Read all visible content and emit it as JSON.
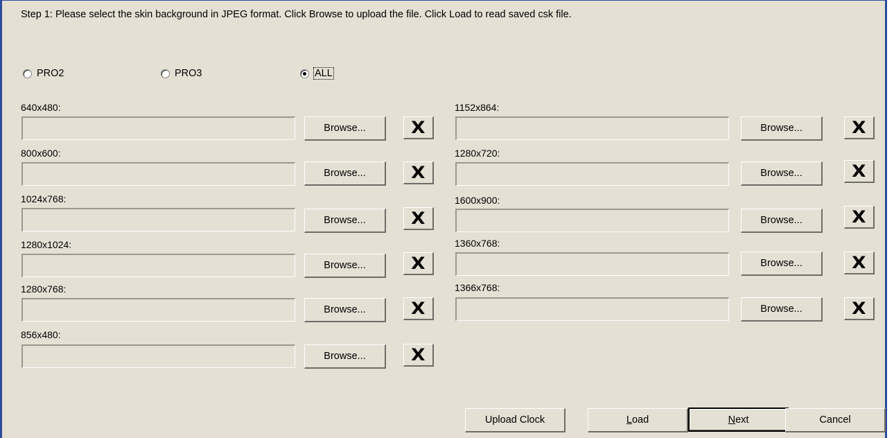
{
  "instruction": "Step 1: Please select the skin background in JPEG format. Click Browse to upload the file. Click Load to read saved csk file.",
  "radios": [
    {
      "label": "PRO2",
      "checked": false
    },
    {
      "label": "PRO3",
      "checked": false
    },
    {
      "label": "ALL",
      "checked": true
    }
  ],
  "left_resolutions": [
    {
      "label": "640x480:",
      "value": ""
    },
    {
      "label": "800x600:",
      "value": ""
    },
    {
      "label": "1024x768:",
      "value": ""
    },
    {
      "label": "1280x1024:",
      "value": ""
    },
    {
      "label": "1280x768:",
      "value": ""
    },
    {
      "label": "856x480:",
      "value": ""
    }
  ],
  "right_resolutions": [
    {
      "label": "1152x864:",
      "value": ""
    },
    {
      "label": "1280x720:",
      "value": ""
    },
    {
      "label": "1600x900:",
      "value": ""
    },
    {
      "label": "1360x768:",
      "value": ""
    },
    {
      "label": "1366x768:",
      "value": ""
    }
  ],
  "browse_label": "Browse...",
  "clear_label": "X",
  "buttons": {
    "upload_clock": "Upload Clock",
    "load_prefix": "",
    "load_accel": "L",
    "load_rest": "oad",
    "next_accel": "N",
    "next_rest": "ext",
    "cancel": "Cancel"
  }
}
